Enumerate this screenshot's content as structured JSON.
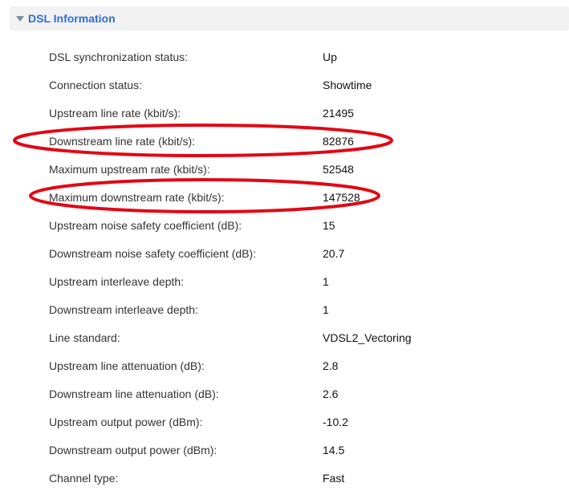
{
  "panel": {
    "title": "DSL Information",
    "rows": [
      {
        "label": "DSL synchronization status:",
        "value": "Up"
      },
      {
        "label": "Connection status:",
        "value": "Showtime"
      },
      {
        "label": "Upstream line rate (kbit/s):",
        "value": "21495"
      },
      {
        "label": "Downstream line rate (kbit/s):",
        "value": "82876"
      },
      {
        "label": "Maximum upstream rate (kbit/s):",
        "value": "52548"
      },
      {
        "label": "Maximum downstream rate (kbit/s):",
        "value": "147528"
      },
      {
        "label": "Upstream noise safety coefficient (dB):",
        "value": "15"
      },
      {
        "label": "Downstream noise safety coefficient (dB):",
        "value": "20.7"
      },
      {
        "label": "Upstream interleave depth:",
        "value": "1"
      },
      {
        "label": "Downstream interleave depth:",
        "value": "1"
      },
      {
        "label": "Line standard:",
        "value": "VDSL2_Vectoring"
      },
      {
        "label": "Upstream line attenuation (dB):",
        "value": "2.8"
      },
      {
        "label": "Downstream line attenuation (dB):",
        "value": "2.6"
      },
      {
        "label": "Upstream output power (dBm):",
        "value": "-10.2"
      },
      {
        "label": "Downstream output power (dBm):",
        "value": "14.5"
      },
      {
        "label": "Channel type:",
        "value": "Fast"
      }
    ]
  },
  "colors": {
    "title": "#2d6fd6",
    "header_bg": "#f2f2f2",
    "highlight": "#e30613"
  },
  "icons": {
    "collapse": "caret-down-icon"
  }
}
